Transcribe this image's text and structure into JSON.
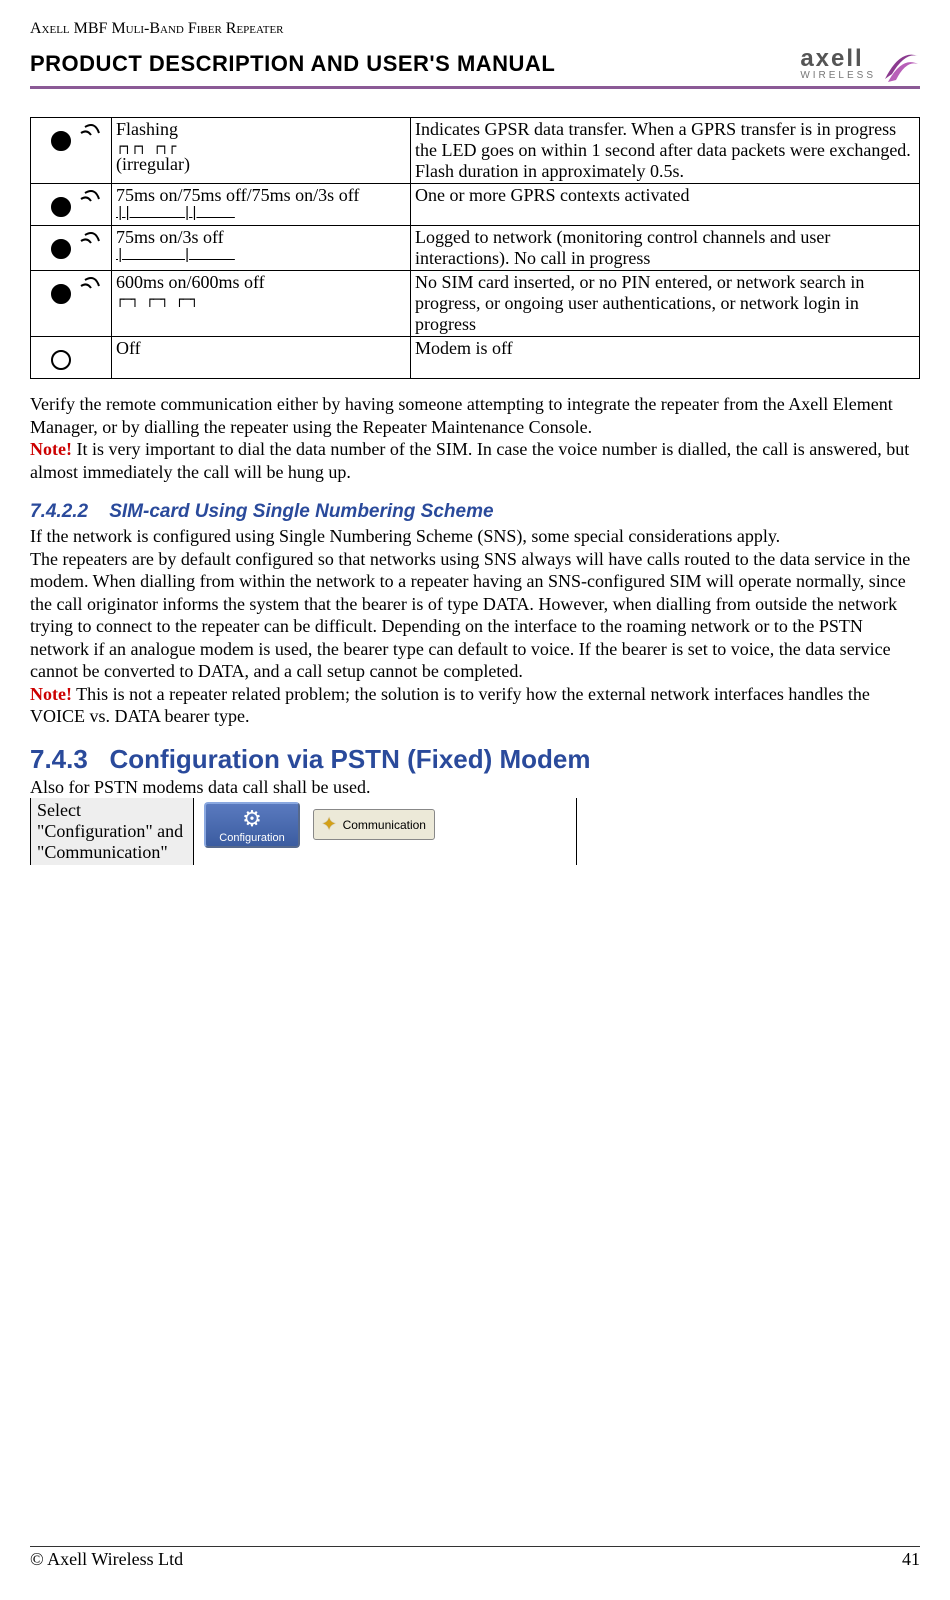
{
  "header": {
    "product_line": "Axell MBF Muli-Band Fiber Repeater",
    "title": "PRODUCT DESCRIPTION AND USER'S MANUAL",
    "logo_main": "axell",
    "logo_sub": "WIRELESS"
  },
  "led_rows": [
    {
      "pattern_label": "Flashing",
      "pattern_extra": "(irregular)",
      "waveform": "┌┐┌┐_┌┐┌",
      "description": "Indicates GPSR data transfer. When a GPRS transfer is in progress the LED goes on within 1 second after data packets were exchanged. Flash duration in approximately 0.5s.",
      "filled": true,
      "waves": true
    },
    {
      "pattern_label": "75ms on/75ms off/75ms on/3s off",
      "waveform": "||_______||_____",
      "description": "One or more GPRS contexts activated",
      "filled": true,
      "waves": true,
      "underline": true
    },
    {
      "pattern_label": "75ms on/3s off",
      "waveform": "|________|______",
      "description": "Logged to network (monitoring control channels and user interactions). No call in progress",
      "filled": true,
      "waves": true,
      "underline": true
    },
    {
      "pattern_label": "600ms on/600ms off",
      "waveform": "┌─┐_┌─┐_┌─┐_",
      "description": "No SIM card inserted, or no PIN entered, or network search in progress, or ongoing user authentications, or network login in progress",
      "filled": true,
      "waves": true
    },
    {
      "pattern_label": "Off",
      "waveform": "",
      "description": "Modem is off",
      "filled": false,
      "waves": false
    }
  ],
  "verify_text": "Verify the remote communication either by having someone attempting to integrate the repeater from the Axell Element Manager, or by dialling the repeater using the Repeater Maintenance Console.",
  "note1_label": "Note!",
  "note1_text": " It is very important to dial the data number of the SIM. In case the voice number is dialled, the call is answered, but almost immediately the call will be hung up.",
  "section_74222": {
    "number": "7.4.2.2",
    "title": "SIM-card Using Single Numbering Scheme",
    "p1": "If the network is configured using Single Numbering Scheme (SNS), some special considerations apply.",
    "p2": "The repeaters are by default configured so that networks using SNS always will have calls routed to the data service in the modem. When dialling from within the network to a repeater having an SNS-configured SIM will operate normally, since the call originator informs the system that the bearer is of type DATA. However, when dialling from outside the network trying to connect to the repeater can be difficult. Depending on the interface to the roaming network or to the PSTN network if an analogue modem is used, the bearer type can default to voice. If the bearer is set to voice, the data service cannot be converted to DATA, and a call setup cannot be completed.",
    "note_label": "Note!",
    "note_text": " This is not a repeater related problem; the solution is to verify how the external network interfaces handles the VOICE vs. DATA bearer type."
  },
  "section_743": {
    "number": "7.4.3",
    "title": "Configuration via PSTN (Fixed) Modem",
    "intro": "Also for PSTN modems data call shall be used.",
    "step_label": "Select \"Configuration\" and \"Communication\"",
    "config_btn": "Configuration",
    "comm_btn": "Communication"
  },
  "footer": {
    "copyright": "© Axell Wireless Ltd",
    "page": "41"
  }
}
